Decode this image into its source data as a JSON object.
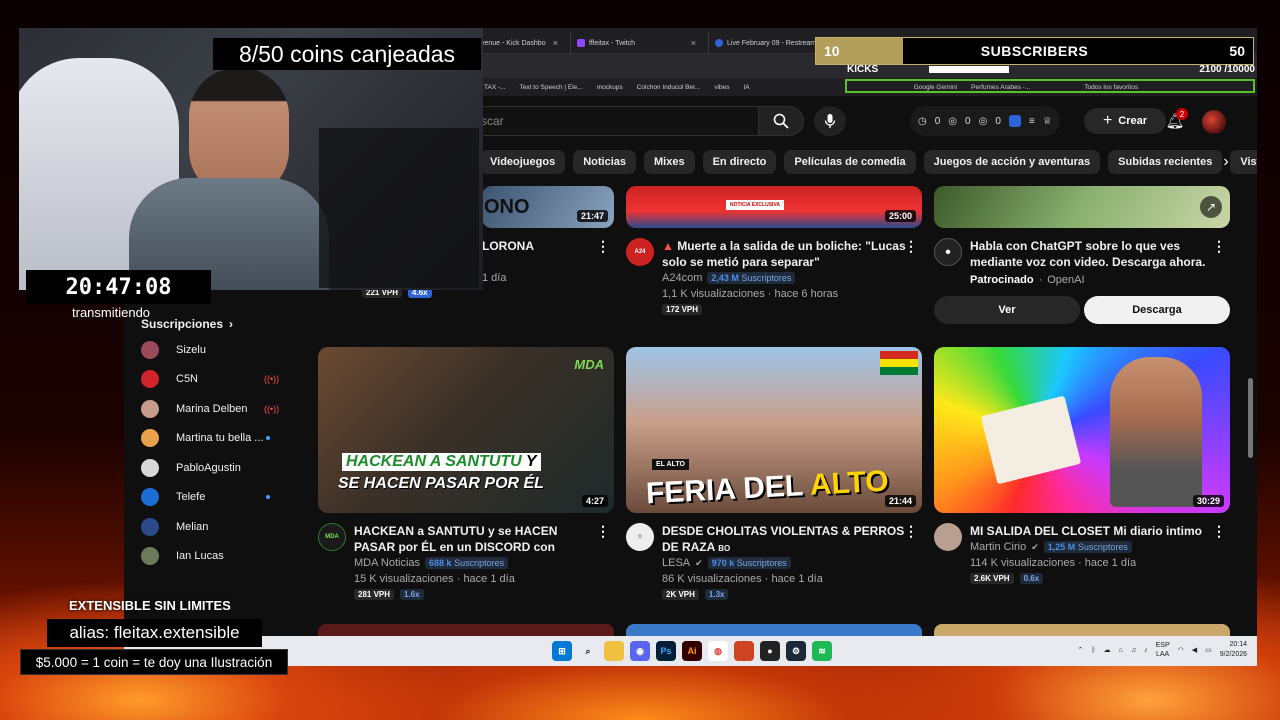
{
  "browser": {
    "tabs": [
      {
        "label": "venue - Kick Dashbo",
        "color": "#53fc18"
      },
      {
        "label": "ffleitax - Twitch",
        "color": "#9146ff"
      },
      {
        "label": "Live February 09 - Restream",
        "color": "#2d63d8"
      }
    ],
    "bookmarks": [
      "TAX -...",
      "Text to Speech | Ele...",
      "mockups",
      "Colchon Inducol Ber...",
      "vibes",
      "IA",
      "Google Gemini",
      "Perfumes Arabes -...",
      "Todos los favoritos"
    ]
  },
  "youtube": {
    "search_placeholder": "scar",
    "stats": [
      "0",
      "0",
      "0"
    ],
    "create_label": "Crear",
    "notif_count": "2",
    "chips": [
      "Videojuegos",
      "Noticias",
      "Mixes",
      "En directo",
      "Películas de comedia",
      "Juegos de acción y aventuras",
      "Subidas recientes",
      "Visto"
    ],
    "sidebar": {
      "section": "Suscripciones",
      "items": [
        {
          "label": "Sizelu",
          "color": "#9b4a5a",
          "mark": ""
        },
        {
          "label": "C5N",
          "color": "#d2232a",
          "mark": "live"
        },
        {
          "label": "Marina Delben",
          "color": "#c79c8c",
          "mark": "live"
        },
        {
          "label": "Martina tu bella ...",
          "color": "#e8a24a",
          "mark": "dot"
        },
        {
          "label": "PabloAgustin",
          "color": "#d8d8d8",
          "mark": ""
        },
        {
          "label": "Telefe",
          "color": "#1c6ed4",
          "mark": "dot"
        },
        {
          "label": "Melian",
          "color": "#2a4a8a",
          "mark": ""
        },
        {
          "label": "Ian Lucas",
          "color": "#6a7a5a",
          "mark": ""
        }
      ]
    },
    "top_row": [
      {
        "title": "LORONA",
        "channel": "",
        "subs": "",
        "views": "1 día",
        "vph": "221 VPH",
        "mult": "4.6x",
        "duration": "21:47"
      },
      {
        "title": "Muerte a la salida de un boliche: \"Lucas solo se metió para separar\"",
        "channel": "A24com",
        "subs_num": "2,43 M",
        "subs_label": "Suscriptores",
        "views": "1,1 K visualizaciones · hace 6 horas",
        "vph": "172 VPH",
        "duration": "25:00",
        "thumb_text": "NOTICIA EXCLUSIVA"
      },
      {
        "title": "Habla con ChatGPT sobre lo que ves mediante voz con video. Descarga ahora.",
        "sponsor": "Patrocinado",
        "advertiser": "OpenAI",
        "btn_view": "Ver",
        "btn_download": "Descarga"
      }
    ],
    "videos": [
      {
        "title": "HACKEAN a SANTUTU y se HACEN PASAR por ÉL en un DISCORD con COKER, GONCHO...",
        "channel": "MDA Noticias",
        "subs_num": "688 k",
        "subs_label": "Suscriptores",
        "views": "15 K visualizaciones · hace 1 día",
        "vph": "281 VPH",
        "mult": "1.6x",
        "duration": "4:27",
        "thumb_line1": "HACKEAN A SANTUTU",
        "thumb_line1b": "Y",
        "thumb_line2": "SE HACEN PASAR POR ÉL",
        "thumb_badge": "MDA"
      },
      {
        "title": "DESDE CHOLITAS VIOLENTAS & PERROS DE RAZA",
        "country": "BO",
        "channel": "LESA",
        "subs_num": "970 k",
        "subs_label": "Suscriptores",
        "views": "86 K visualizaciones · hace 1 día",
        "vph": "2K VPH",
        "mult": "1.3x",
        "duration": "21:44",
        "thumb_line1": "FERIA DEL",
        "thumb_line1b": "ALTO",
        "thumb_tag": "EL ALTO"
      },
      {
        "title": "MI SALIDA DEL CLOSET  Mi diario intimo",
        "channel": "Martin Cirio",
        "subs_num": "1,25 M",
        "subs_label": "Suscriptores",
        "views": "114 K visualizaciones · hace 1 día",
        "vph": "2.6K VPH",
        "mult": "0.6x",
        "duration": "30:29"
      }
    ]
  },
  "taskbar": {
    "lang1": "ESP",
    "lang2": "LAA",
    "time": "20:14",
    "date": "9/2/2026"
  },
  "overlay": {
    "coins": "8/50 coins canjeadas",
    "timer": "20:47:08",
    "status": "transmitiendo",
    "subs_current": "10",
    "subs_label": "SUBSCRIBERS",
    "subs_goal": "50",
    "subs_progress": 0.2,
    "kicks_label": "KICKS",
    "kicks_value": "2100 /10000",
    "kicks_progress": 0.21,
    "ext_title": "EXTENSIBLE SIN LIMITES",
    "alias": "alias: fleitax.extensible",
    "price": "$5.000 = 1 coin = te doy una Ilustración"
  }
}
